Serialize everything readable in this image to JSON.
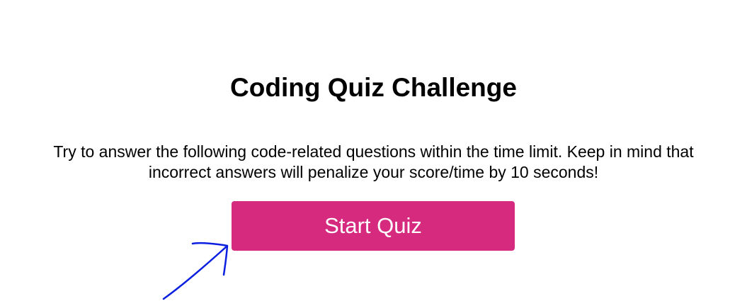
{
  "quiz": {
    "title": "Coding Quiz Challenge",
    "description": "Try to answer the following code-related questions within the time limit. Keep in mind that incorrect answers will penalize your score/time by 10 seconds!",
    "start_label": "Start Quiz"
  },
  "colors": {
    "button_bg": "#d62a7f",
    "annotation_arrow": "#0a1fe0"
  },
  "icons": {
    "annotation": "hand-drawn-arrow-icon"
  }
}
